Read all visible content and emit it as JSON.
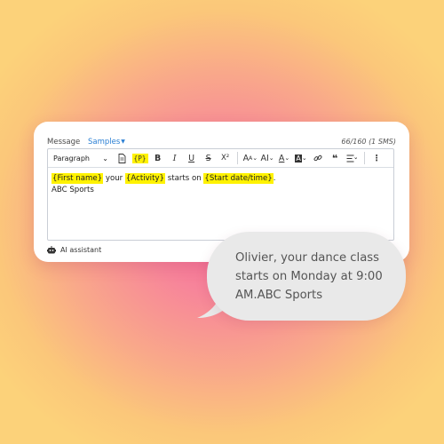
{
  "header": {
    "message_label": "Message",
    "samples_label": "Samples",
    "counter": "66/160 (1 SMS)"
  },
  "toolbar": {
    "paragraph_select": "Paragraph",
    "personalize_label": "{P}",
    "bold": "B",
    "italic": "I",
    "underline": "U",
    "strike": "S",
    "superscript": "X²",
    "font_size": "A",
    "text_style": "AI",
    "text_color": "A",
    "highlight": "A",
    "quote": "❝"
  },
  "editor": {
    "tag_first_name": "{First name}",
    "text_your": "your",
    "tag_activity": "{Activity}",
    "text_starts_on": "starts on",
    "tag_start": "{Start date/time}",
    "text_period": ".",
    "line2": "ABC Sports"
  },
  "footer": {
    "ai_label": "AI assistant"
  },
  "preview": {
    "text": "Olivier, your dance class starts on Monday at 9:00 AM.ABC Sports"
  },
  "colors": {
    "highlight": "#fff200",
    "link": "#2a7fd4",
    "bubble": "#e9e9e9"
  }
}
